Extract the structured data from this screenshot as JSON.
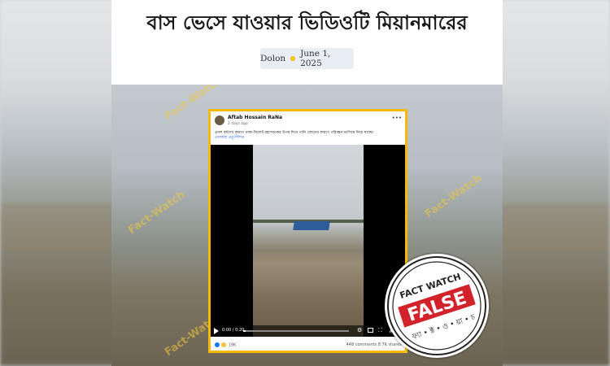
{
  "article": {
    "title": "বাস ভেসে যাওয়ার ভিডিওটি মিয়ানমারের",
    "author": "Dolon",
    "date": "June 1, 2025"
  },
  "post": {
    "author": "Aftab Hossain RaNa",
    "time": "2 days ago",
    "text": "প্রবল বর্ষণের কারণে ঢাকা-সিলেট মহাসড়কের উপর দিয়ে পানি স্রোতের কারণে পরিবহন ভাসিয়ে নিয়ে যাচ্ছে।",
    "see_more": "এমআরা প্রতুপীলিত",
    "video_time": "0:00 / 0:20",
    "reactions": "19K",
    "comments": "448 comments",
    "shares": "8.7K shares"
  },
  "watermark": "Fact-Watch",
  "stamp": {
    "verdict": "FALSE",
    "brand_top": "FACT WATCH",
    "brand_bottom": "ফ্যা • ক্ট • ও • য়া • চ"
  },
  "colors": {
    "accent": "#f5b90a",
    "verdict": "#d2232a",
    "meta_bg": "#e9edf4"
  },
  "icons": [
    "avatar",
    "more-icon",
    "play-icon",
    "settings-icon",
    "pip-icon",
    "fullscreen-icon",
    "volume-icon",
    "reaction-icons"
  ]
}
